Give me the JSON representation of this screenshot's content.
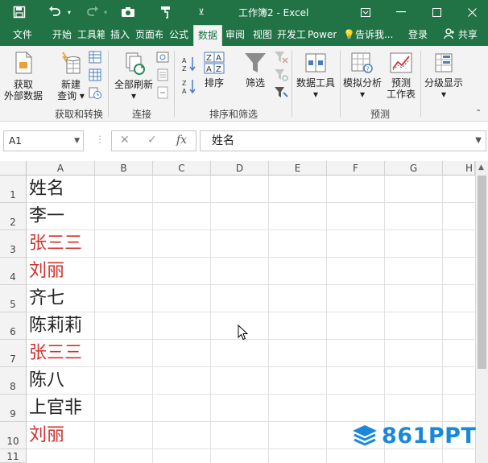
{
  "window": {
    "title": "工作簿2 - Excel",
    "qat": {
      "save_icon": "save-icon",
      "undo_icon": "undo-icon",
      "redo_icon": "redo-icon",
      "camera_icon": "camera-icon",
      "brush_icon": "format-painter-icon",
      "more_icon": "customize-qat-icon"
    }
  },
  "tabs": [
    {
      "label": "文件"
    },
    {
      "label": "开始"
    },
    {
      "label": "工具箱"
    },
    {
      "label": "插入"
    },
    {
      "label": "页面布局"
    },
    {
      "label": "公式"
    },
    {
      "label": "数据",
      "active": true
    },
    {
      "label": "审阅"
    },
    {
      "label": "视图"
    },
    {
      "label": "开发工具"
    },
    {
      "label": "Power Pivot"
    }
  ],
  "tell_me": "告诉我...",
  "login": "登录",
  "share": "共享",
  "ribbon": {
    "get_external": {
      "line1": "获取",
      "line2": "外部数据"
    },
    "new_query": {
      "line1": "新建",
      "line2": "查询"
    },
    "group_get_transform": "获取和转换",
    "refresh_all": "全部刷新",
    "group_connections": "连接",
    "sort": "排序",
    "filter": "筛选",
    "group_sort_filter": "排序和筛选",
    "data_tools": "数据工具",
    "what_if": "模拟分析",
    "forecast_sheet": {
      "line1": "预测",
      "line2": "工作表"
    },
    "group_forecast": "预测",
    "outline": "分级显示"
  },
  "formula_bar": {
    "name_box": "A1",
    "cancel": "✕",
    "enter": "✓",
    "fx": "fx",
    "content": "姓名"
  },
  "columns": [
    "A",
    "B",
    "C",
    "D",
    "E",
    "F",
    "G",
    "H"
  ],
  "rows": [
    {
      "num": "1",
      "a": "姓名",
      "color": "#222222"
    },
    {
      "num": "2",
      "a": "李一",
      "color": "#222222"
    },
    {
      "num": "3",
      "a": "张三三",
      "color": "#d0312d"
    },
    {
      "num": "4",
      "a": "刘丽",
      "color": "#d0312d"
    },
    {
      "num": "5",
      "a": "齐七",
      "color": "#222222"
    },
    {
      "num": "6",
      "a": "陈莉莉",
      "color": "#222222"
    },
    {
      "num": "7",
      "a": "张三三",
      "color": "#d0312d"
    },
    {
      "num": "8",
      "a": "陈八",
      "color": "#222222"
    },
    {
      "num": "9",
      "a": "上官非",
      "color": "#222222"
    },
    {
      "num": "10",
      "a": "刘丽",
      "color": "#d0312d"
    },
    {
      "num": "11",
      "a": "",
      "color": "#222222"
    }
  ],
  "watermark": "861PPT",
  "colors": {
    "excel_green": "#217346",
    "duplicate_red": "#d0312d",
    "watermark_blue": "#1a88d8"
  }
}
